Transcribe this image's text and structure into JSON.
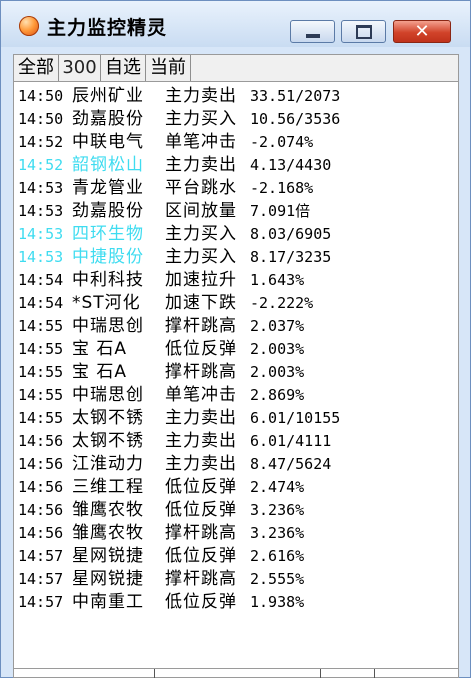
{
  "window": {
    "title": "主力监控精灵",
    "icon": "app-orb-icon",
    "controls": {
      "minimize": "minimize-icon",
      "maximize": "maximize-icon",
      "close_label": "✕"
    }
  },
  "tabs": [
    {
      "label": "全部",
      "selected": true
    },
    {
      "label": "300",
      "selected": false
    },
    {
      "label": "自选",
      "selected": false
    },
    {
      "label": "当前",
      "selected": false
    }
  ],
  "colors": {
    "highlight": "#3fdcf0",
    "normal": "#000000"
  },
  "rows": [
    {
      "time": "14:50",
      "name": "辰州矿业",
      "event": "主力卖出",
      "value": "33.51/2073",
      "highlight": false
    },
    {
      "time": "14:50",
      "name": "劲嘉股份",
      "event": "主力买入",
      "value": "10.56/3536",
      "highlight": false
    },
    {
      "time": "14:52",
      "name": "中联电气",
      "event": "单笔冲击",
      "value": "-2.074%",
      "highlight": false
    },
    {
      "time": "14:52",
      "name": "韶钢松山",
      "event": "主力卖出",
      "value": "4.13/4430",
      "highlight": true
    },
    {
      "time": "14:53",
      "name": "青龙管业",
      "event": "平台跳水",
      "value": "-2.168%",
      "highlight": false
    },
    {
      "time": "14:53",
      "name": "劲嘉股份",
      "event": "区间放量",
      "value": "7.091倍",
      "highlight": false
    },
    {
      "time": "14:53",
      "name": "四环生物",
      "event": "主力买入",
      "value": "8.03/6905",
      "highlight": true
    },
    {
      "time": "14:53",
      "name": "中捷股份",
      "event": "主力买入",
      "value": "8.17/3235",
      "highlight": true
    },
    {
      "time": "14:54",
      "name": "中利科技",
      "event": "加速拉升",
      "value": "1.643%",
      "highlight": false
    },
    {
      "time": "14:54",
      "name": "*ST河化",
      "event": "加速下跌",
      "value": "-2.222%",
      "highlight": false
    },
    {
      "time": "14:55",
      "name": "中瑞思创",
      "event": "撑杆跳高",
      "value": "2.037%",
      "highlight": false
    },
    {
      "time": "14:55",
      "name": "宝  石A",
      "event": "低位反弹",
      "value": "2.003%",
      "highlight": false
    },
    {
      "time": "14:55",
      "name": "宝  石A",
      "event": "撑杆跳高",
      "value": "2.003%",
      "highlight": false
    },
    {
      "time": "14:55",
      "name": "中瑞思创",
      "event": "单笔冲击",
      "value": "2.869%",
      "highlight": false
    },
    {
      "time": "14:55",
      "name": "太钢不锈",
      "event": "主力卖出",
      "value": "6.01/10155",
      "highlight": false
    },
    {
      "time": "14:56",
      "name": "太钢不锈",
      "event": "主力卖出",
      "value": "6.01/4111",
      "highlight": false
    },
    {
      "time": "14:56",
      "name": "江淮动力",
      "event": "主力卖出",
      "value": "8.47/5624",
      "highlight": false
    },
    {
      "time": "14:56",
      "name": "三维工程",
      "event": "低位反弹",
      "value": "2.474%",
      "highlight": false
    },
    {
      "time": "14:56",
      "name": "雏鹰农牧",
      "event": "低位反弹",
      "value": "3.236%",
      "highlight": false
    },
    {
      "time": "14:56",
      "name": "雏鹰农牧",
      "event": "撑杆跳高",
      "value": "3.236%",
      "highlight": false
    },
    {
      "time": "14:57",
      "name": "星网锐捷",
      "event": "低位反弹",
      "value": "2.616%",
      "highlight": false
    },
    {
      "time": "14:57",
      "name": "星网锐捷",
      "event": "撑杆跳高",
      "value": "2.555%",
      "highlight": false
    },
    {
      "time": "14:57",
      "name": "中南重工",
      "event": "低位反弹",
      "value": "1.938%",
      "highlight": false
    }
  ]
}
